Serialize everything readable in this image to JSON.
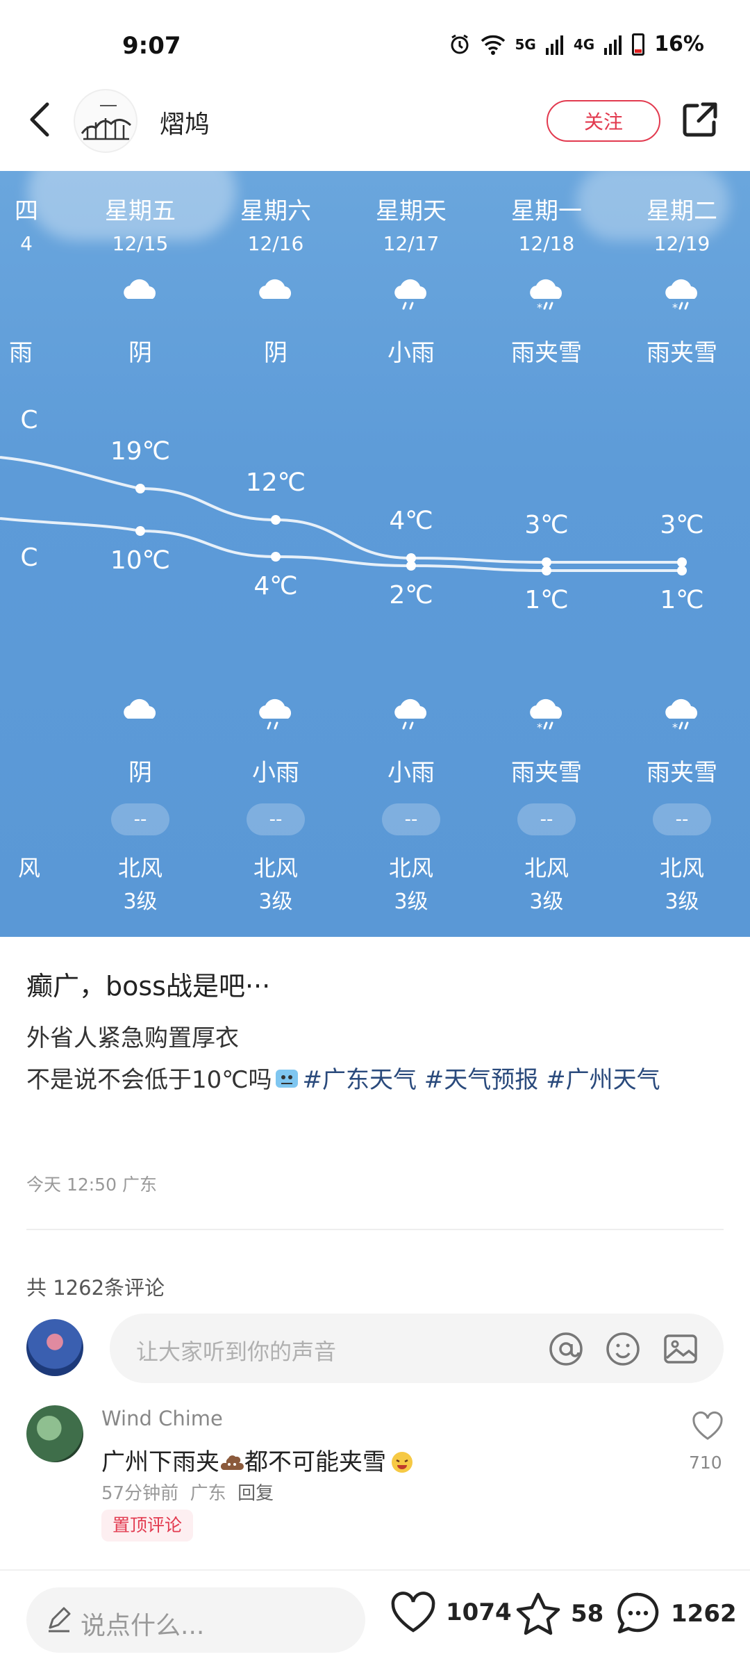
{
  "status_bar": {
    "time": "9:07",
    "network1": "5G",
    "network2": "4G",
    "battery": "16%"
  },
  "header": {
    "author": "熠鸠",
    "follow_label": "关注"
  },
  "weather": {
    "partial_left": {
      "day": "四",
      "date": "4",
      "cond": "雨",
      "hi_unit": "C",
      "lo_unit": "C",
      "wind": "风"
    },
    "days": [
      {
        "day": "星期五",
        "date": "12/15",
        "cond_day": "阴",
        "high": "19℃",
        "low": "10℃",
        "cond_night": "阴",
        "aqi": "--",
        "wind": "北风",
        "level": "3级",
        "icon_day": "cloud-icon",
        "icon_night": "cloud-icon"
      },
      {
        "day": "星期六",
        "date": "12/16",
        "cond_day": "阴",
        "high": "12℃",
        "low": "4℃",
        "cond_night": "小雨",
        "aqi": "--",
        "wind": "北风",
        "level": "3级",
        "icon_day": "cloud-icon",
        "icon_night": "light-rain-icon"
      },
      {
        "day": "星期天",
        "date": "12/17",
        "cond_day": "小雨",
        "high": "4℃",
        "low": "2℃",
        "cond_night": "小雨",
        "aqi": "--",
        "wind": "北风",
        "level": "3级",
        "icon_day": "light-rain-icon",
        "icon_night": "light-rain-icon"
      },
      {
        "day": "星期一",
        "date": "12/18",
        "cond_day": "雨夹雪",
        "high": "3℃",
        "low": "1℃",
        "cond_night": "雨夹雪",
        "aqi": "--",
        "wind": "北风",
        "level": "3级",
        "icon_day": "sleet-icon",
        "icon_night": "sleet-icon"
      },
      {
        "day": "星期二",
        "date": "12/19",
        "cond_day": "雨夹雪",
        "high": "3℃",
        "low": "1℃",
        "cond_night": "雨夹雪",
        "aqi": "--",
        "wind": "北风",
        "level": "3级",
        "icon_day": "sleet-icon",
        "icon_night": "sleet-icon"
      }
    ]
  },
  "post": {
    "title": "癫广，boss战是吧···",
    "line1": "外省人紧急购置厚衣",
    "line2": "不是说不会低于10℃吗",
    "tags": [
      "#广东天气",
      "#天气预报",
      "#广州天气"
    ],
    "meta": "今天 12:50 广东"
  },
  "comments": {
    "count_label": "共 1262条评论",
    "input_placeholder": "让大家听到你的声音",
    "items": [
      {
        "name": "Wind Chime",
        "text_before": "广州下雨夹",
        "text_after": "都不可能夹雪",
        "time": "57分钟前",
        "location": "广东",
        "reply": "回复",
        "pin": "置顶评论",
        "likes": "710"
      }
    ]
  },
  "bottom_bar": {
    "placeholder": "说点什么...",
    "likes": "1074",
    "favorites": "58",
    "comments": "1262"
  },
  "colors": {
    "accent": "#e23a4f",
    "tag": "#2a4a7c",
    "sky": "#5d9bd8"
  }
}
